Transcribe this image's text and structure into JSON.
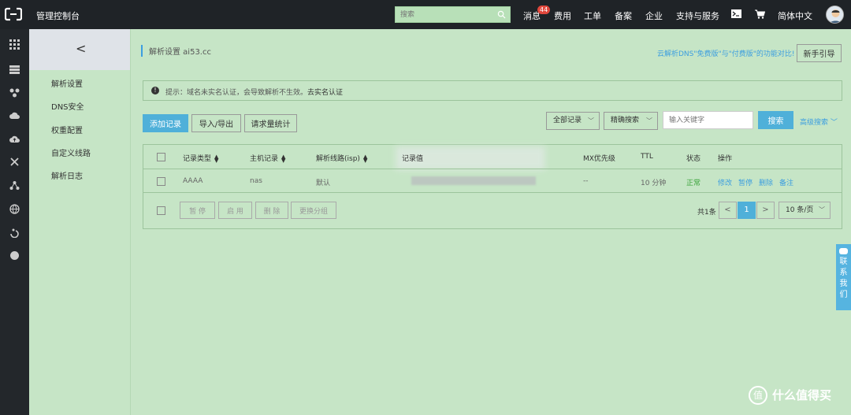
{
  "colors": {
    "topbar": "#1f2327",
    "rail": "#23272b",
    "accent": "#4fb0d9",
    "link": "#3c9ee0",
    "content_bg": "#c6e5c6",
    "status_ok": "#3aa33a",
    "badge": "#e0473c"
  },
  "topbar": {
    "title": "管理控制台",
    "search_placeholder": "搜索",
    "nav": {
      "messages": "消息",
      "messages_badge": "44",
      "billing": "费用",
      "ticket": "工单",
      "icp": "备案",
      "enterprise": "企业",
      "support": "支持与服务",
      "language": "简体中文"
    },
    "icons": [
      "terminal-icon",
      "cart-icon",
      "avatar"
    ]
  },
  "rail_icons": [
    "grid-icon",
    "database-icon",
    "network-icon",
    "cloud-icon",
    "cloud-upload-icon",
    "cross-arrows-icon",
    "cluster-icon",
    "globe-icon",
    "cdn-icon",
    "circle-icon"
  ],
  "sidebar": {
    "collapse": "<",
    "items": [
      "解析设置",
      "DNS安全",
      "权重配置",
      "自定义线路",
      "解析日志"
    ]
  },
  "main": {
    "page_title": "解析设置 ai53.cc",
    "compare_link": "云解析DNS\"免费版\"与\"付费版\"的功能对比!",
    "guide_button": "新手引导",
    "tip": {
      "text": "提示：域名未实名认证，会导致解析不生效。",
      "link": "去实名认证"
    },
    "toolbar": {
      "add_record": "添加记录",
      "import_export": "导入/导出",
      "request_stats": "请求量统计",
      "record_filter": "全部记录",
      "search_mode": "精确搜索",
      "keyword_placeholder": "输入关键字",
      "search_button": "搜索",
      "advanced_search": "高级搜索"
    },
    "table": {
      "headers": {
        "type": "记录类型",
        "host": "主机记录",
        "line": "解析线路(isp)",
        "value": "记录值",
        "mx": "MX优先级",
        "ttl": "TTL",
        "status": "状态",
        "actions": "操作"
      },
      "rows": [
        {
          "type": "AAAA",
          "host": "nas",
          "line": "默认",
          "value": "",
          "mx": "--",
          "ttl": "10 分钟",
          "status": "正常",
          "actions": [
            "修改",
            "暂停",
            "删除",
            "备注"
          ]
        }
      ]
    },
    "footer": {
      "pause": "暂 停",
      "enable": "启 用",
      "delete": "删 除",
      "change_group": "更换分组",
      "total": "共1条",
      "prev": "<",
      "current_page": "1",
      "next": ">",
      "page_size": "10 条/页"
    }
  },
  "contact": {
    "label": [
      "联",
      "系",
      "我",
      "们"
    ]
  },
  "watermark": {
    "logo": "值",
    "text": "什么值得买"
  }
}
